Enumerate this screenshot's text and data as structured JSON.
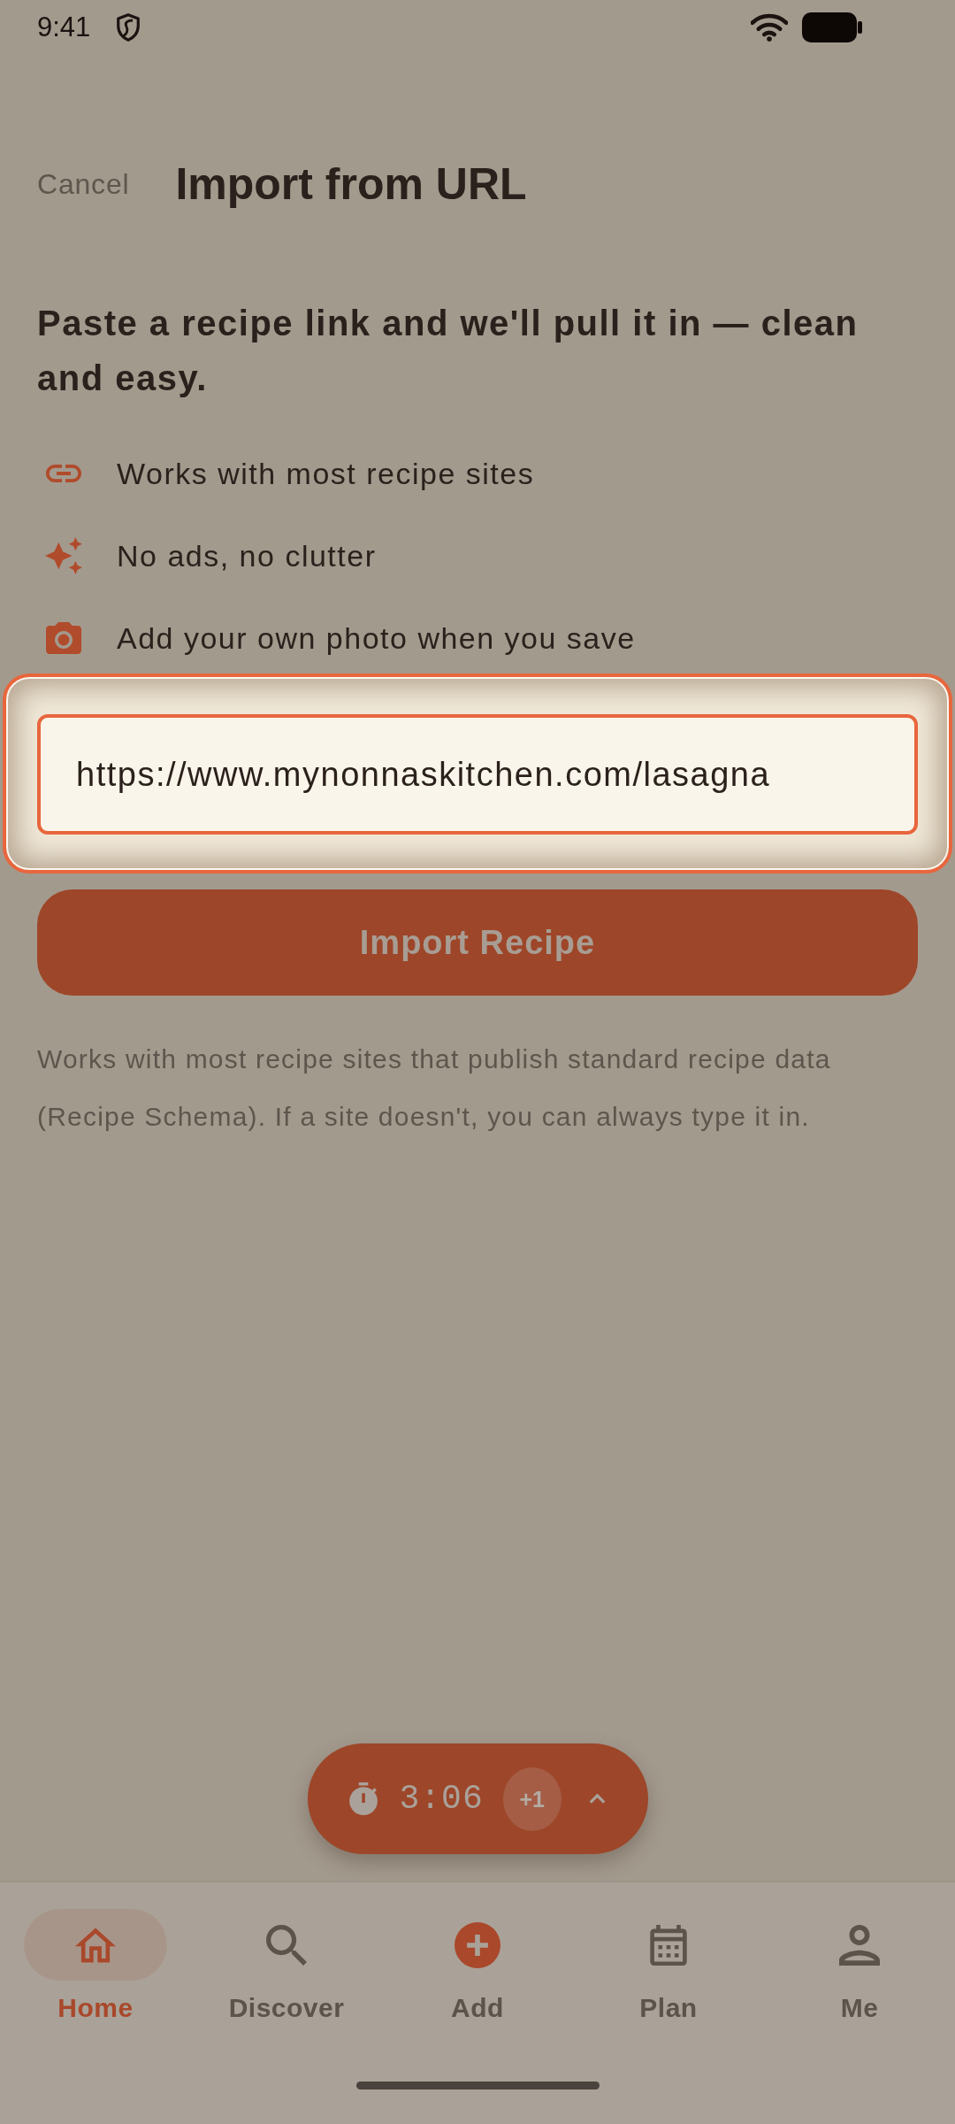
{
  "status_bar": {
    "time": "9:41"
  },
  "header": {
    "cancel": "Cancel",
    "title": "Import from URL"
  },
  "intro": "Paste a recipe link and we'll pull it in — clean and easy.",
  "features": [
    "Works with most recipe sites",
    "No ads, no clutter",
    "Add your own photo when you save"
  ],
  "url_field": {
    "value": "https://www.mynonnaskitchen.com/lasagna",
    "highlighted": true
  },
  "import_button": {
    "label": "Import Recipe"
  },
  "note": "Works with most recipe sites that publish standard recipe data (Recipe Schema). If a site doesn't, you can always type it in.",
  "timer": {
    "time": "3:06",
    "add_button": "+1"
  },
  "bottom_nav": [
    {
      "label": "Home",
      "selected": true
    },
    {
      "label": "Discover",
      "selected": false
    },
    {
      "label": "Add",
      "selected": false
    },
    {
      "label": "Plan",
      "selected": false
    },
    {
      "label": "Me",
      "selected": false
    }
  ]
}
